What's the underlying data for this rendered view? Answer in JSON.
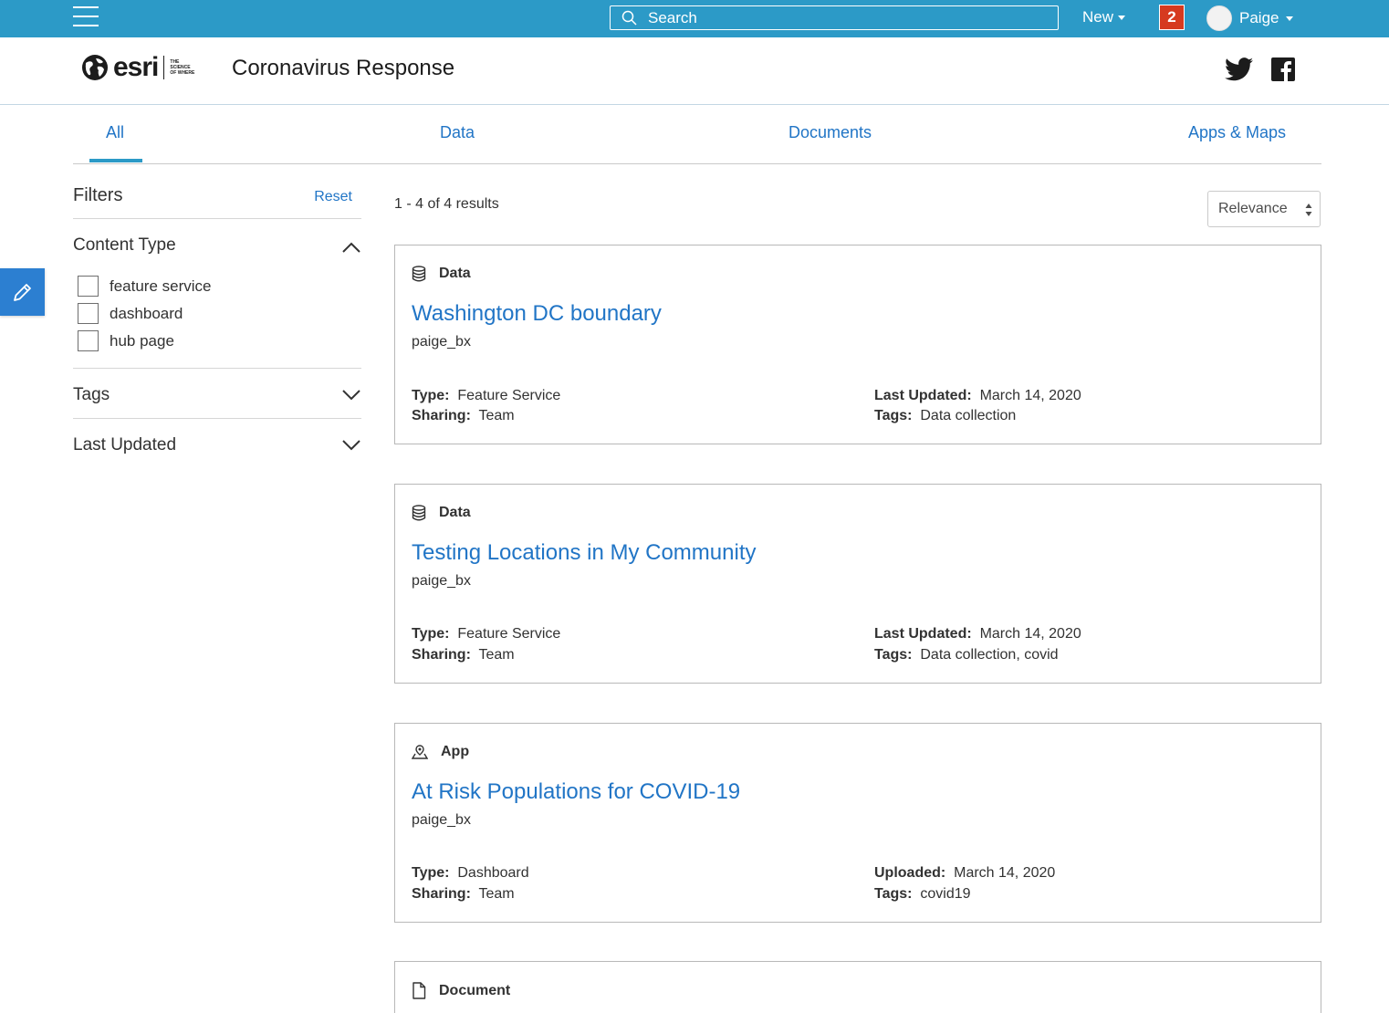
{
  "topbar": {
    "search_placeholder": "Search",
    "new_label": "New",
    "notification_count": "2",
    "user_name": "Paige"
  },
  "header": {
    "logo_text": "esri",
    "logo_tagline": "THE SCIENCE OF WHERE",
    "site_title": "Coronavirus Response"
  },
  "tabs": [
    {
      "label": "All",
      "active": true
    },
    {
      "label": "Data"
    },
    {
      "label": "Documents"
    },
    {
      "label": "Apps & Maps"
    }
  ],
  "filters": {
    "title": "Filters",
    "reset_label": "Reset",
    "content_type": {
      "title": "Content Type",
      "options": [
        "feature service",
        "dashboard",
        "hub page"
      ]
    },
    "tags_title": "Tags",
    "last_updated_title": "Last Updated"
  },
  "results": {
    "count_text": "1 - 4 of 4 results",
    "sort_value": "Relevance",
    "cards": [
      {
        "kind": "Data",
        "title": "Washington DC boundary",
        "owner": "paige_bx",
        "type_label": "Type:",
        "type_value": "Feature Service",
        "sharing_label": "Sharing:",
        "sharing_value": "Team",
        "date_label": "Last Updated:",
        "date_value": "March 14, 2020",
        "tags_label": "Tags:",
        "tags_value": "Data collection"
      },
      {
        "kind": "Data",
        "title": "Testing Locations in My Community",
        "owner": "paige_bx",
        "type_label": "Type:",
        "type_value": "Feature Service",
        "sharing_label": "Sharing:",
        "sharing_value": "Team",
        "date_label": "Last Updated:",
        "date_value": "March 14, 2020",
        "tags_label": "Tags:",
        "tags_value": "Data collection, covid"
      },
      {
        "kind": "App",
        "title": "At Risk Populations for COVID-19",
        "owner": "paige_bx",
        "type_label": "Type:",
        "type_value": "Dashboard",
        "sharing_label": "Sharing:",
        "sharing_value": "Team",
        "date_label": "Uploaded:",
        "date_value": "March 14, 2020",
        "tags_label": "Tags:",
        "tags_value": "covid19"
      },
      {
        "kind": "Document"
      }
    ]
  },
  "colors": {
    "topbar": "#2c9ac7",
    "link": "#2175c6",
    "notification": "#d63a1f",
    "edit_button": "#2c7fd1"
  }
}
